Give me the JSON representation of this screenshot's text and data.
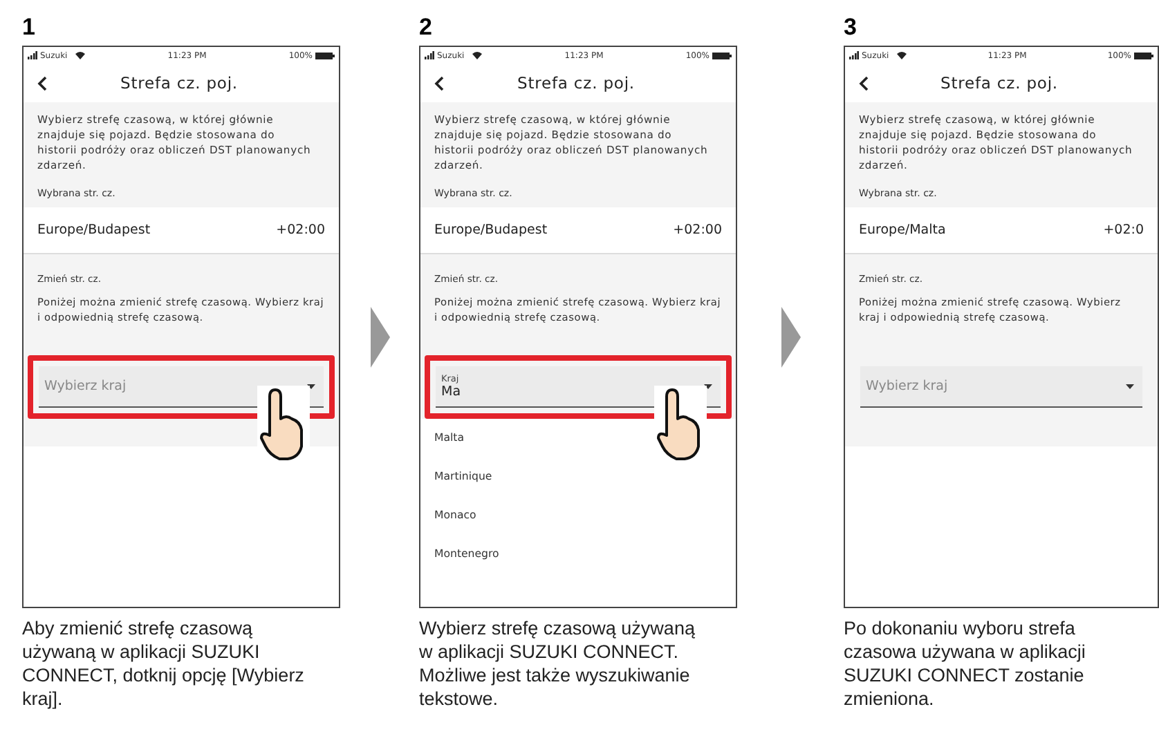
{
  "steps": [
    {
      "number": "1",
      "screen": {
        "status": {
          "carrier": "Suzuki",
          "time": "11:23 PM",
          "battery": "100%"
        },
        "title": "Strefa cz. poj.",
        "intro": "Wybierz strefę czasową, w której głównie znajduje się pojazd. Będzie stosowana do historii podróży oraz obliczeń DST planowanych zdarzeń.",
        "selected_label": "Wybrana str. cz.",
        "selected_zone": "Europe/Budapest",
        "selected_offset": "+02:00",
        "change_label": "Zmień str. cz.",
        "change_text": "Poniżej można zmienić strefę czasową. Wybierz kraj i odpowiednią strefę czasową.",
        "field": {
          "placeholder": "Wybierz kraj"
        },
        "highlighted": true,
        "touch": true
      },
      "caption": "Aby zmienić strefę czasową używaną w aplikacji SUZUKI CONNECT, dotknij opcję [Wybierz kraj]."
    },
    {
      "number": "2",
      "screen": {
        "status": {
          "carrier": "Suzuki",
          "time": "11:23 PM",
          "battery": "100%"
        },
        "title": "Strefa cz. poj.",
        "intro": "Wybierz strefę czasową, w której głównie znajduje się pojazd. Będzie stosowana do historii podróży oraz obliczeń DST planowanych zdarzeń.",
        "selected_label": "Wybrana str. cz.",
        "selected_zone": "Europe/Budapest",
        "selected_offset": "+02:00",
        "change_label": "Zmień str. cz.",
        "change_text": "Poniżej można zmienić strefę czasową. Wybierz kraj i odpowiednią strefę czasową.",
        "field": {
          "label": "Kraj",
          "value": "Ma"
        },
        "options": [
          "Malta",
          "Martinique",
          "Monaco",
          "Montenegro"
        ],
        "highlighted": true,
        "touch": true
      },
      "caption": "Wybierz strefę czasową używaną w aplikacji SUZUKI CONNECT. Możliwe jest także wyszukiwanie tekstowe."
    },
    {
      "number": "3",
      "screen": {
        "status": {
          "carrier": "Suzuki",
          "time": "11:23 PM",
          "battery": "100%"
        },
        "title": "Strefa cz. poj.",
        "intro": "Wybierz strefę czasową, w której głównie znajduje się pojazd. Będzie stosowana do historii podróży oraz obliczeń DST planowanych zdarzeń.",
        "selected_label": "Wybrana str. cz.",
        "selected_zone": "Europe/Malta",
        "selected_offset": "+02:0",
        "change_label": "Zmień str. cz.",
        "change_text": "Poniżej można zmienić strefę czasową. Wybierz kraj i odpowiednią strefę czasową.",
        "field": {
          "placeholder": "Wybierz kraj"
        },
        "highlighted": false,
        "touch": false
      },
      "caption": "Po dokonaniu wyboru strefa czasowa używana w aplikacji SUZUKI CONNECT zostanie zmieniona."
    }
  ]
}
